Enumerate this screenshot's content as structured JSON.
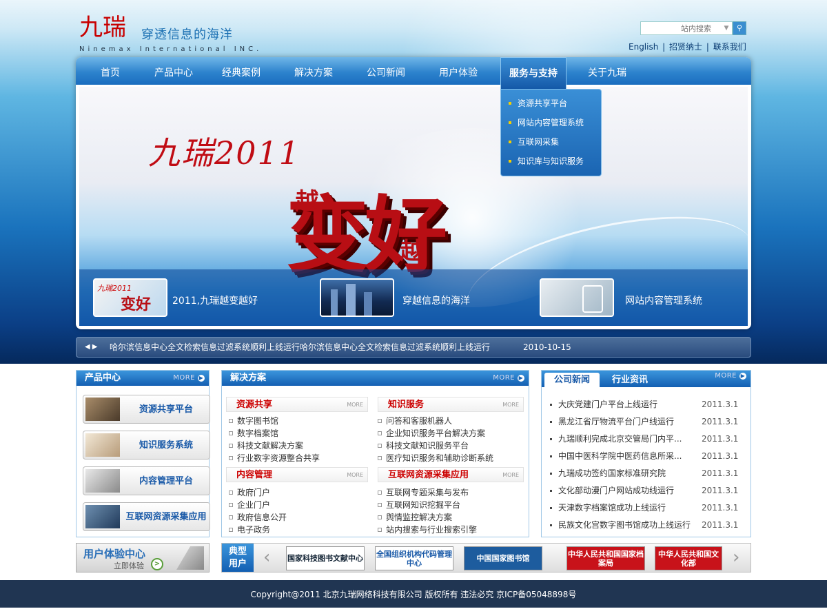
{
  "header": {
    "logo_text": "九瑞",
    "slogan": "穿透信息的海洋",
    "company_en": "Ninemax International INC.",
    "search_placeholder": "站内搜索",
    "links": [
      "English",
      "招贤纳士",
      "联系我们"
    ]
  },
  "nav": {
    "items": [
      "首页",
      "产品中心",
      "经典案例",
      "解决方案",
      "公司新闻",
      "用户体验",
      "服务与支持",
      "关于九瑞"
    ],
    "active": "服务与支持",
    "dropdown": [
      "资源共享平台",
      "网站内容管理系统",
      "互联网采集",
      "知识库与知识服务"
    ]
  },
  "banner": {
    "headline": "九瑞2011",
    "big_text": "变好",
    "small_left": "越",
    "small_right": "越",
    "thumbs": [
      {
        "caption": "2011,九瑞越变越好",
        "mini": "九瑞2011"
      },
      {
        "caption": "穿越信息的海洋"
      },
      {
        "caption": "网站内容管理系统"
      }
    ]
  },
  "ticker": {
    "text": "哈尔滨信息中心全文检索信息过滤系统顺利上线运行哈尔滨信息中心全文检索信息过滤系统顺利上线运行",
    "date": "2010-10-15"
  },
  "products": {
    "title": "产品中心",
    "more": "MORE",
    "items": [
      "资源共享平台",
      "知识服务系统",
      "内容管理平台",
      "互联网资源采集应用"
    ]
  },
  "solutions": {
    "title": "解决方案",
    "more": "MORE",
    "sub_more": "MORE",
    "groups": [
      {
        "title": "资源共享",
        "items": [
          "数字图书馆",
          "数字档案馆",
          "科技文献解决方案",
          "行业数字资源整合共享"
        ]
      },
      {
        "title": "知识服务",
        "items": [
          "问答和客服机器人",
          "企业知识服务平台解决方案",
          "科技文献知识服务平台",
          "医疗知识服务和辅助诊断系统"
        ]
      },
      {
        "title": "内容管理",
        "items": [
          "政府门户",
          "企业门户",
          "政府信息公开",
          "电子政务"
        ]
      },
      {
        "title": "互联网资源采集应用",
        "items": [
          "互联网专题采集与发布",
          "互联网知识挖掘平台",
          "舆情监控解决方案",
          "站内搜索与行业搜索引擎"
        ]
      }
    ]
  },
  "news": {
    "tab_active": "公司新闻",
    "tab_other": "行业资讯",
    "more": "MORE",
    "items": [
      {
        "title": "大庆党建门户平台上线运行",
        "date": "2011.3.1"
      },
      {
        "title": "黑龙江省厅物流平台门户线运行",
        "date": "2011.3.1"
      },
      {
        "title": "九瑞顺利完成北京交管局门内平...",
        "date": "2011.3.1"
      },
      {
        "title": "中国中医科学院中医药信息所采...",
        "date": "2011.3.1"
      },
      {
        "title": "九瑞成功签约国家标准研究院",
        "date": "2011.3.1"
      },
      {
        "title": "文化部动漫门户网站成功线运行",
        "date": "2011.3.1"
      },
      {
        "title": "天津数字档案馆成功上线运行",
        "date": "2011.3.1"
      },
      {
        "title": "民族文化宫数字图书馆成功上线运行",
        "date": "2011.3.1"
      }
    ]
  },
  "experience": {
    "title": "用户体验中心",
    "cta": "立即体验"
  },
  "typical_users": {
    "label_1": "典型",
    "label_2": "用户",
    "logos": [
      "国家科技图书文献中心",
      "全国组织机构代码管理中心",
      "中国国家图书馆",
      "中华人民共和国国家档案局",
      "中华人民共和国文化部"
    ]
  },
  "footer": {
    "text": "Copyright@2011 北京九瑞网络科技有限公司 版权所有 违法必究 京ICP备05048898号"
  }
}
